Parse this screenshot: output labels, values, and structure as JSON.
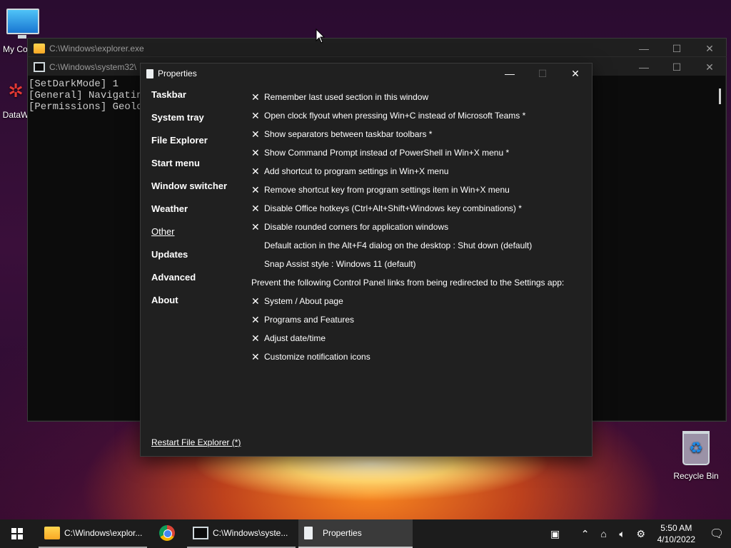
{
  "desktop": {
    "icons": [
      {
        "label": "My Co",
        "icon": "this-pc-icon"
      },
      {
        "label": "DataW",
        "icon": "datawarehouse-icon"
      },
      {
        "label": "Recycle Bin",
        "icon": "recycle-bin-icon"
      }
    ]
  },
  "explorer_window": {
    "title": "C:\\Windows\\explorer.exe",
    "controls": {
      "minimize": "—",
      "maximize": "☐",
      "close": "✕"
    }
  },
  "console_window": {
    "title": "C:\\Windows\\system32\\",
    "lines": [
      "[SetDarkMode] 1",
      "[General] Navigating",
      "[Permissions] Geoloc"
    ]
  },
  "properties": {
    "title": "Properties",
    "controls": {
      "minimize": "—",
      "maximize": "☐",
      "close": "✕"
    },
    "nav": [
      {
        "label": "Taskbar",
        "active": false
      },
      {
        "label": "System tray",
        "active": false
      },
      {
        "label": "File Explorer",
        "active": false
      },
      {
        "label": "Start menu",
        "active": false
      },
      {
        "label": "Window switcher",
        "active": false
      },
      {
        "label": "Weather",
        "active": false
      },
      {
        "label": "Other",
        "active": true
      },
      {
        "label": "Updates",
        "active": false
      },
      {
        "label": "Advanced",
        "active": false
      },
      {
        "label": "About",
        "active": false
      }
    ],
    "options": [
      {
        "mark": "✕",
        "text": "Remember last used section in this window"
      },
      {
        "mark": "✕",
        "text": "Open clock flyout when pressing Win+C instead of Microsoft Teams *"
      },
      {
        "mark": "✕",
        "text": "Show separators between taskbar toolbars *"
      },
      {
        "mark": "✕",
        "text": "Show Command Prompt instead of PowerShell in Win+X menu *"
      },
      {
        "mark": "✕",
        "text": "Add shortcut to program settings in Win+X menu"
      },
      {
        "mark": "✕",
        "text": "Remove shortcut key from program settings item in Win+X menu"
      },
      {
        "mark": "✕",
        "text": "Disable Office hotkeys (Ctrl+Alt+Shift+Windows key combinations) *"
      },
      {
        "mark": "✕",
        "text": "Disable rounded corners for application windows"
      },
      {
        "mark": "",
        "text": "Default action in the Alt+F4 dialog on the desktop : Shut down (default)"
      },
      {
        "mark": "",
        "text": "Snap Assist style : Windows 11 (default)"
      }
    ],
    "redirect_header": "Prevent the following Control Panel links from being redirected to the Settings app:",
    "redirect_options": [
      {
        "mark": "✕",
        "text": "System / About page"
      },
      {
        "mark": "✕",
        "text": "Programs and Features"
      },
      {
        "mark": "✕",
        "text": "Adjust date/time"
      },
      {
        "mark": "✕",
        "text": "Customize notification icons"
      }
    ],
    "restart_link": "Restart File Explorer (*)"
  },
  "taskbar": {
    "tasks": [
      {
        "label": "C:\\Windows\\explor...",
        "icon": "folder-icon"
      },
      {
        "label": "",
        "icon": "chrome-icon"
      },
      {
        "label": "C:\\Windows\\syste...",
        "icon": "cmd-icon"
      },
      {
        "label": "Properties",
        "icon": "properties-icon"
      }
    ],
    "tray": {
      "time": "5:50 AM",
      "date": "4/10/2022"
    }
  }
}
